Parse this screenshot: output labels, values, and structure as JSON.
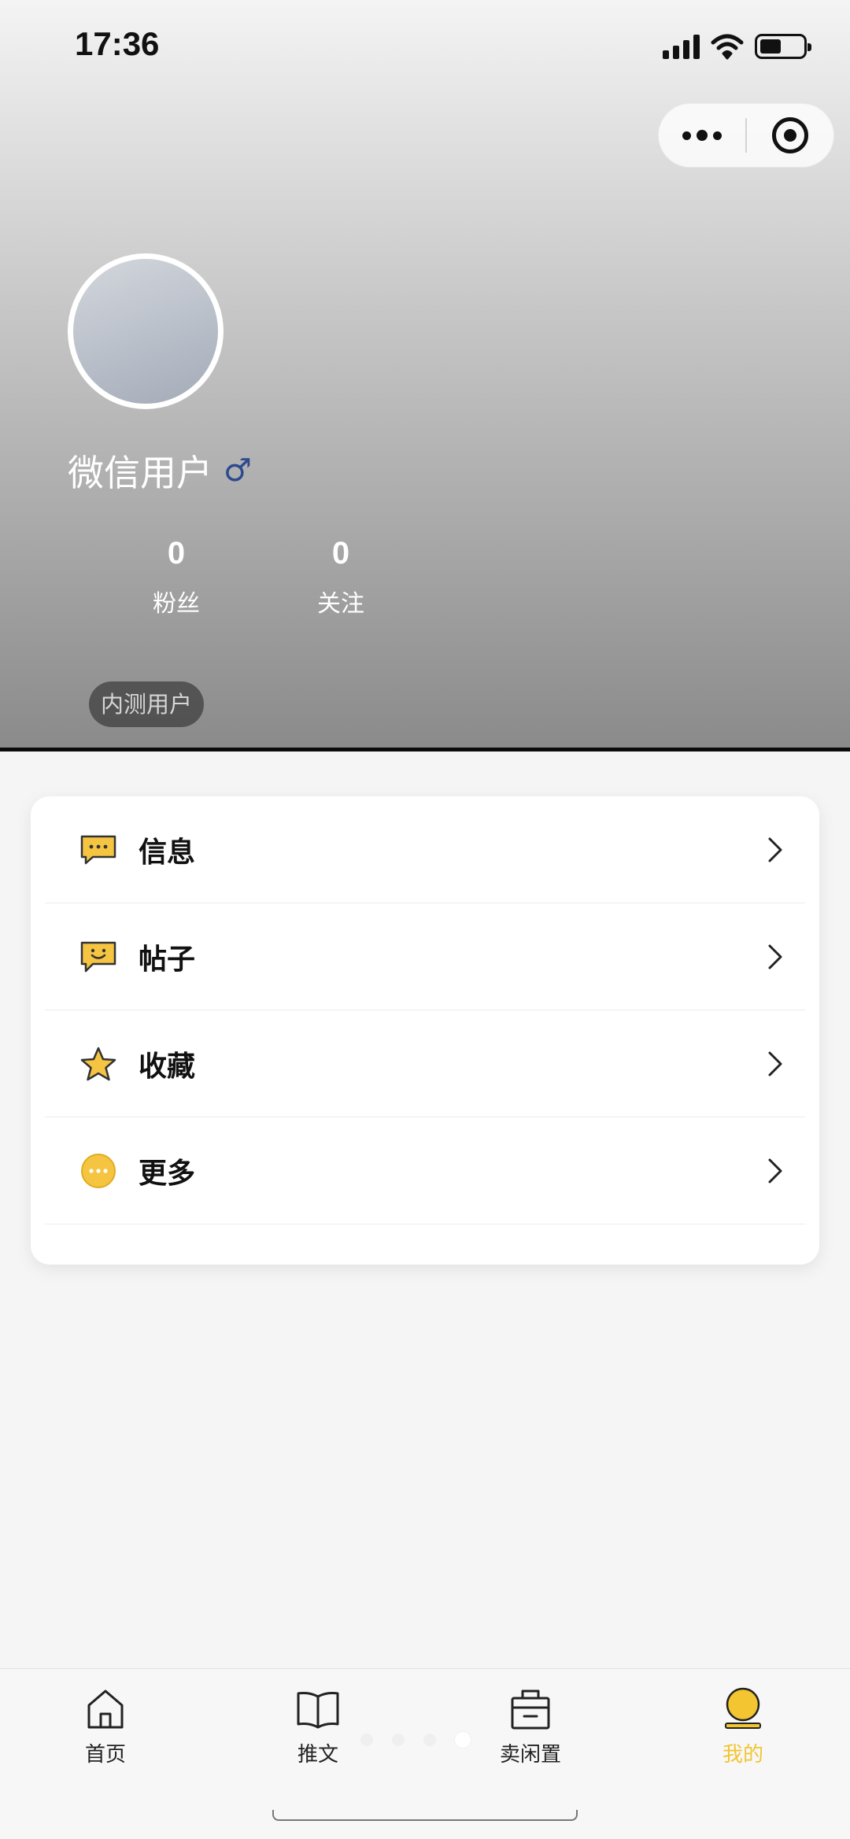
{
  "status_bar": {
    "time": "17:36"
  },
  "profile": {
    "username": "微信用户",
    "gender_symbol": "♂",
    "stats": [
      {
        "value": "0",
        "label": "粉丝"
      },
      {
        "value": "0",
        "label": "关注"
      }
    ],
    "badge": "内测用户"
  },
  "menu": {
    "items": [
      {
        "label": "信息",
        "icon": "message-icon"
      },
      {
        "label": "帖子",
        "icon": "smile-chat-icon"
      },
      {
        "label": "收藏",
        "icon": "star-icon"
      },
      {
        "label": "更多",
        "icon": "more-circle-icon"
      }
    ]
  },
  "tabbar": {
    "tabs": [
      {
        "label": "首页",
        "icon": "home-icon"
      },
      {
        "label": "推文",
        "icon": "book-icon"
      },
      {
        "label": "卖闲置",
        "icon": "bag-icon"
      },
      {
        "label": "我的",
        "icon": "user-icon",
        "active": true
      }
    ]
  },
  "colors": {
    "accent": "#f2c531",
    "gender": "#2d4a8f"
  }
}
